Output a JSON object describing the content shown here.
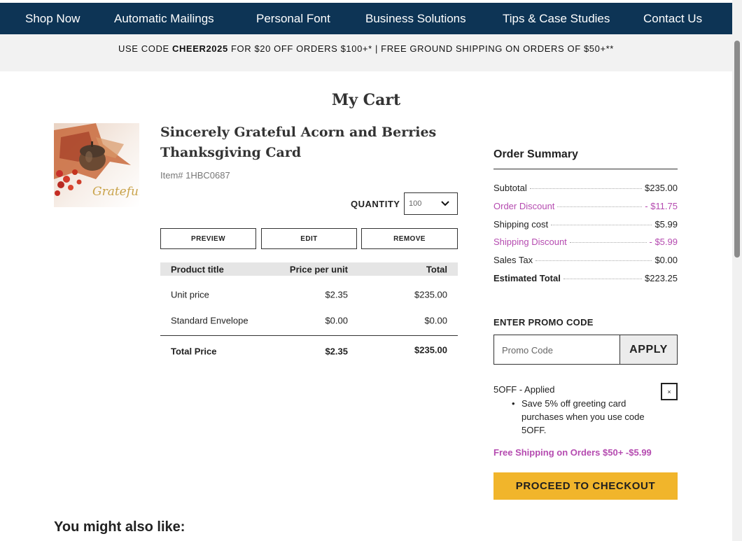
{
  "nav": {
    "items": [
      "Shop Now",
      "Automatic Mailings",
      "Personal Font",
      "Business Solutions",
      "Tips & Case Studies",
      "Contact Us"
    ]
  },
  "promo_banner": {
    "prefix": "USE CODE ",
    "code": "CHEER2025",
    "suffix": " FOR $20 OFF ORDERS $100+* | FREE GROUND SHIPPING ON ORDERS OF $50+**"
  },
  "page_title": "My Cart",
  "product": {
    "title": "Sincerely Grateful Acorn and Berries Thanksgiving Card",
    "item_number": "Item# 1HBC0687",
    "image_text": "Grateful",
    "quantity_label": "QUANTITY",
    "quantity_value": "100",
    "actions": [
      "PREVIEW",
      "EDIT",
      "REMOVE"
    ]
  },
  "price_table": {
    "headers": [
      "Product title",
      "Price per unit",
      "Total"
    ],
    "rows": [
      {
        "title": "Unit price",
        "price": "$2.35",
        "total": "$235.00"
      },
      {
        "title": "Standard Envelope",
        "price": "$0.00",
        "total": "$0.00"
      }
    ],
    "total_row": {
      "title": "Total Price",
      "price": "$2.35",
      "total": "$235.00"
    }
  },
  "summary": {
    "title": "Order Summary",
    "rows": [
      {
        "label": "Subtotal",
        "value": "$235.00"
      },
      {
        "label": "Order Discount",
        "value": "- $11.75"
      },
      {
        "label": "Shipping cost",
        "value": "$5.99"
      },
      {
        "label": "Shipping Discount",
        "value": "- $5.99"
      },
      {
        "label": "Sales Tax",
        "value": "$0.00"
      },
      {
        "label": "Estimated Total",
        "value": "$223.25"
      }
    ]
  },
  "promo": {
    "label": "ENTER PROMO CODE",
    "placeholder": "Promo Code",
    "apply_label": "APPLY",
    "applied_code": "5OFF - Applied",
    "applied_description": "Save 5% off greeting card purchases when you use code 5OFF.",
    "remove_symbol": "×",
    "free_shipping": "Free Shipping on Orders $50+ -$5.99"
  },
  "checkout_label": "PROCEED TO CHECKOUT",
  "recommendations_title": "You might also like:",
  "colors": {
    "nav_bg": "#0d3455",
    "discount": "#b54bb0",
    "checkout": "#f1b52b"
  },
  "icons": {
    "quantity_dropdown": "chevron-down-icon",
    "remove_promo": "close-icon"
  }
}
